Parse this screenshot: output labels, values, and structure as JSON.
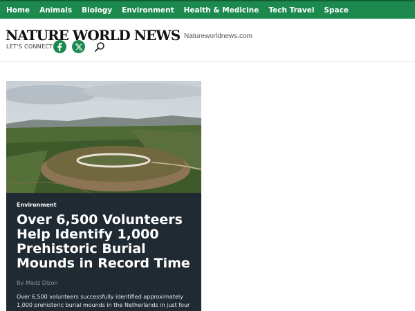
{
  "nav": {
    "items": [
      "Home",
      "Animals",
      "Biology",
      "Environment",
      "Health & Medicine",
      "Tech Travel",
      "Space"
    ]
  },
  "header": {
    "logo": "NATURE WORLD NEWS",
    "site_url": "Natureworldnews.com",
    "connect_label": "LET'S CONNECT",
    "social_icons": [
      "facebook-icon",
      "x-icon"
    ],
    "search_icon": "search-icon"
  },
  "article": {
    "category": "Environment",
    "title": "Over 6,500 Volunteers Help Identify 1,000 Prehistoric Burial Mounds in Record Time",
    "byline_prefix": "By",
    "author": "Madz Dizon",
    "summary": "Over 6,500 volunteers successfully identified approximately 1,000 prehistoric burial mounds in the Netherlands in just four"
  },
  "colors": {
    "nav_bg": "#1c8a4f",
    "card_bg": "#1f2a33",
    "accent": "#1c8a4f"
  }
}
